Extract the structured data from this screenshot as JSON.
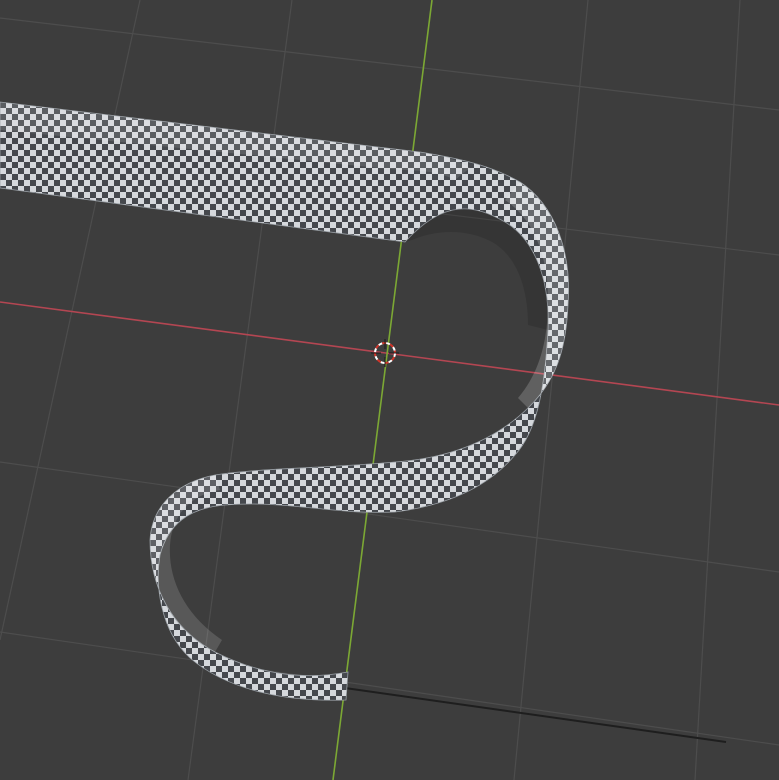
{
  "viewport": {
    "background_color": "#3d3d3d",
    "grid_color": "#4d4d4d",
    "x_axis_color": "#b44652",
    "y_axis_color": "#7ca834"
  },
  "object": {
    "type": "curved-ribbon-mesh",
    "texture": "checker",
    "checker_light": "#d5d8dc",
    "checker_dark": "#45484d"
  },
  "cursor": {
    "icon": "3d-cursor-icon",
    "ring_color_a": "#ffffff",
    "ring_color_b": "#d0352a"
  }
}
